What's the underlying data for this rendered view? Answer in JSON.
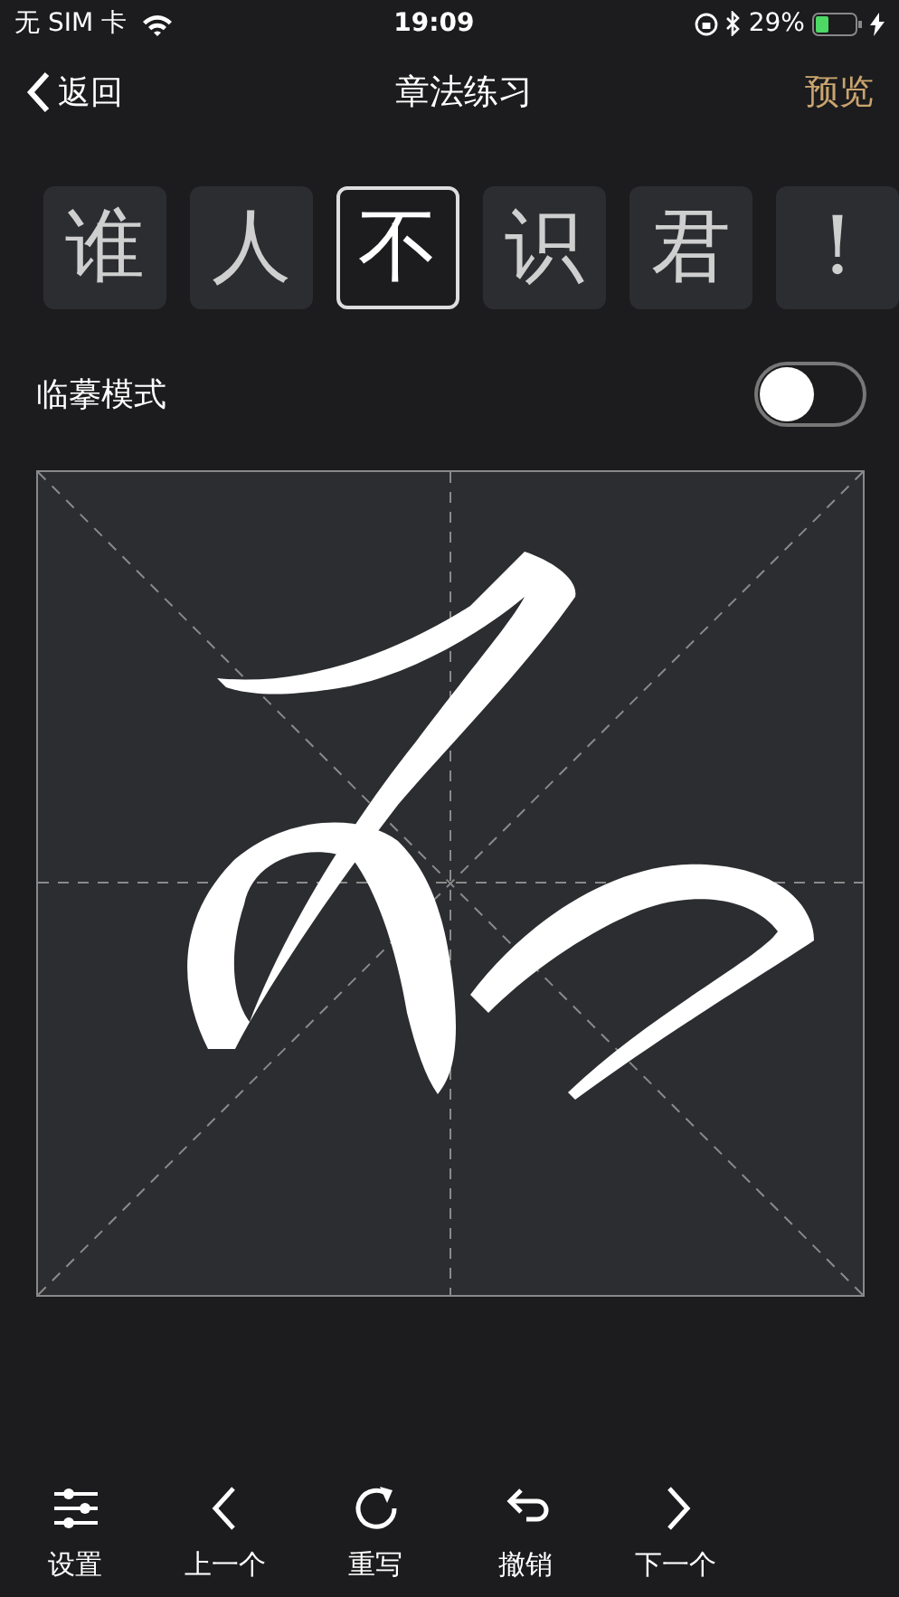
{
  "status_bar": {
    "carrier": "无 SIM 卡",
    "time": "19:09",
    "battery": "29%"
  },
  "nav": {
    "back": "返回",
    "title": "章法练习",
    "action": "预览"
  },
  "characters": [
    {
      "text": "谁",
      "selected": false
    },
    {
      "text": "人",
      "selected": false
    },
    {
      "text": "不",
      "selected": true
    },
    {
      "text": "识",
      "selected": false
    },
    {
      "text": "君",
      "selected": false
    },
    {
      "text": "!",
      "selected": false
    }
  ],
  "tracing_mode": {
    "label": "临摹模式",
    "on": false
  },
  "toolbar": [
    {
      "kind": "settings",
      "label": "设置"
    },
    {
      "kind": "prev",
      "label": "上一个"
    },
    {
      "kind": "rewrite",
      "label": "重写"
    },
    {
      "kind": "undo",
      "label": "撤销"
    },
    {
      "kind": "next",
      "label": "下一个"
    }
  ]
}
